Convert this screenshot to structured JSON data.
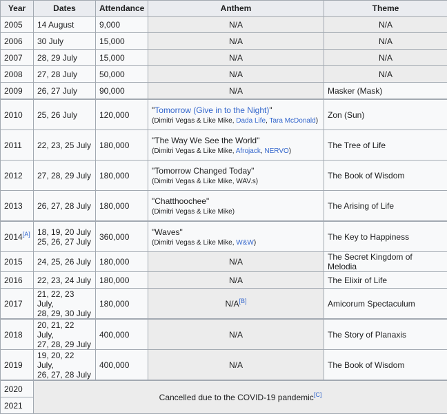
{
  "headers": [
    "Year",
    "Dates",
    "Attendance",
    "Anthem",
    "Theme"
  ],
  "rows": [
    {
      "year": "2005",
      "dates": [
        "14 August"
      ],
      "attendance": "9,000",
      "anthem": "N/A",
      "theme": "N/A"
    },
    {
      "year": "2006",
      "dates": [
        "30 July"
      ],
      "attendance": "15,000",
      "anthem": "N/A",
      "theme": "N/A"
    },
    {
      "year": "2007",
      "dates": [
        "28, 29 July"
      ],
      "attendance": "15,000",
      "anthem": "N/A",
      "theme": "N/A"
    },
    {
      "year": "2008",
      "dates": [
        "27, 28 July"
      ],
      "attendance": "50,000",
      "anthem": "N/A",
      "theme": "N/A"
    },
    {
      "year": "2009",
      "dates": [
        "26, 27 July"
      ],
      "attendance": "90,000",
      "anthem": "N/A",
      "theme": "Masker (Mask)"
    },
    {
      "year": "2010",
      "dates": [
        "25, 26 July"
      ],
      "attendance": "120,000",
      "anthem_title": "Tomorrow (Give in to the Night)",
      "anthem_title_linked": true,
      "credits": [
        {
          "text": "(Dimitri Vegas & Like Mike, ",
          "link": false
        },
        {
          "text": "Dada Life",
          "link": true
        },
        {
          "text": ", ",
          "link": false
        },
        {
          "text": "Tara McDonald",
          "link": true
        },
        {
          "text": ")",
          "link": false
        }
      ],
      "theme": "Zon (Sun)"
    },
    {
      "year": "2011",
      "dates": [
        "22, 23, 25 July"
      ],
      "attendance": "180,000",
      "anthem_title": "The Way We See the World",
      "anthem_title_linked": false,
      "credits": [
        {
          "text": "(Dimitri Vegas & Like Mike, ",
          "link": false
        },
        {
          "text": "Afrojack",
          "link": true
        },
        {
          "text": ", ",
          "link": false
        },
        {
          "text": "NERVO",
          "link": true
        },
        {
          "text": ")",
          "link": false
        }
      ],
      "theme": "The Tree of Life"
    },
    {
      "year": "2012",
      "dates": [
        "27, 28, 29 July"
      ],
      "attendance": "180,000",
      "anthem_title": "Tomorrow Changed Today",
      "anthem_title_linked": false,
      "credits": [
        {
          "text": "(Dimitri Vegas & Like Mike, WAV.s)",
          "link": false
        }
      ],
      "theme": "The Book of Wisdom"
    },
    {
      "year": "2013",
      "dates": [
        "26, 27, 28 July"
      ],
      "attendance": "180,000",
      "anthem_title": "Chatthoochee",
      "anthem_title_linked": false,
      "credits": [
        {
          "text": "(Dimitri Vegas & Like Mike)",
          "link": false
        }
      ],
      "theme": "The Arising of Life"
    },
    {
      "year": "2014",
      "year_note": "[A]",
      "dates": [
        "18, 19, 20 July",
        "25, 26, 27 July"
      ],
      "attendance": "360,000",
      "anthem_title": "Waves",
      "anthem_title_linked": false,
      "credits": [
        {
          "text": "(Dimitri Vegas & Like Mike, ",
          "link": false
        },
        {
          "text": "W&W",
          "link": true
        },
        {
          "text": ")",
          "link": false
        }
      ],
      "theme": "The Key to Happiness"
    },
    {
      "year": "2015",
      "dates": [
        "24, 25, 26 July"
      ],
      "attendance": "180,000",
      "anthem": "N/A",
      "theme": "The Secret Kingdom of Melodia"
    },
    {
      "year": "2016",
      "dates": [
        "22, 23, 24 July"
      ],
      "attendance": "180,000",
      "anthem": "N/A",
      "theme": "The Elixir of Life"
    },
    {
      "year": "2017",
      "dates": [
        "21, 22, 23 July,",
        "28, 29, 30 July"
      ],
      "attendance": "180,000",
      "anthem": "N/A",
      "anthem_note": "[B]",
      "theme": "Amicorum Spectaculum"
    },
    {
      "year": "2018",
      "dates": [
        "20, 21, 22 July,",
        "27, 28, 29 July"
      ],
      "attendance": "400,000",
      "anthem": "N/A",
      "theme": "The Story of Planaxis"
    },
    {
      "year": "2019",
      "dates": [
        "19, 20, 22 July,",
        "26, 27, 28 July"
      ],
      "attendance": "400,000",
      "anthem": "N/A",
      "theme": "The Book of Wisdom"
    }
  ],
  "cancelled": {
    "years": [
      "2020",
      "2021"
    ],
    "text": "Cancelled due to the COVID-19 pandemic",
    "note": "[C]"
  }
}
